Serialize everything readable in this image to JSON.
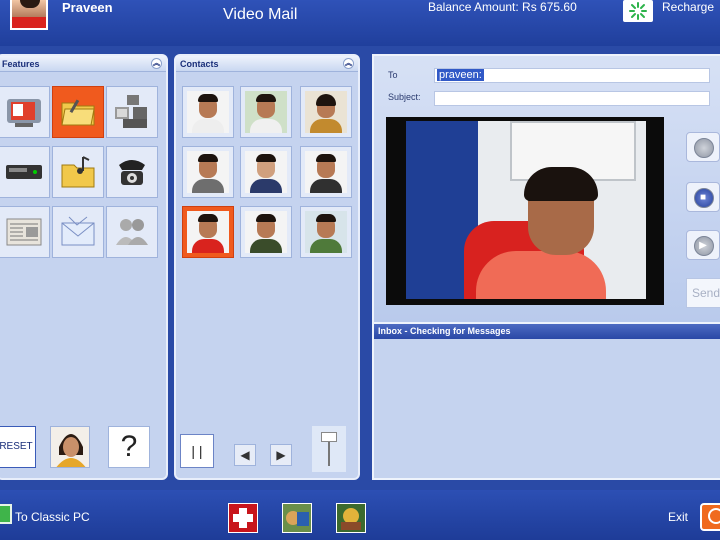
{
  "header": {
    "username": "Praveen",
    "app_title": "Video Mail",
    "balance": "Balance Amount: Rs 675.60",
    "recharge_label": "Recharge"
  },
  "features": {
    "title": "Features",
    "icons": [
      "tv-icon",
      "folder-icon",
      "media-gallery-icon",
      "vcr-icon",
      "music-folder-icon",
      "telephone-icon",
      "newspaper-icon",
      "mail-icon",
      "users-icon"
    ],
    "selected_index": 1,
    "reset_label": "RESET",
    "help_label": "?"
  },
  "contacts": {
    "title": "Contacts",
    "count": 9,
    "selected_index": 6,
    "pause_label": "| |",
    "prev_label": "◀",
    "next_label": "▶"
  },
  "compose": {
    "to_label": "To",
    "to_value": "praveen:",
    "subject_label": "Subject:",
    "subject_value": "",
    "send_label": "Send"
  },
  "inbox": {
    "status": "Inbox - Checking for Messages"
  },
  "footer": {
    "classic_label": "To Classic PC",
    "exit_label": "Exit"
  },
  "colors": {
    "brand_blue": "#2a4aa6",
    "selection_orange": "#f05a1e",
    "panel_bg": "#c5d3ef"
  }
}
